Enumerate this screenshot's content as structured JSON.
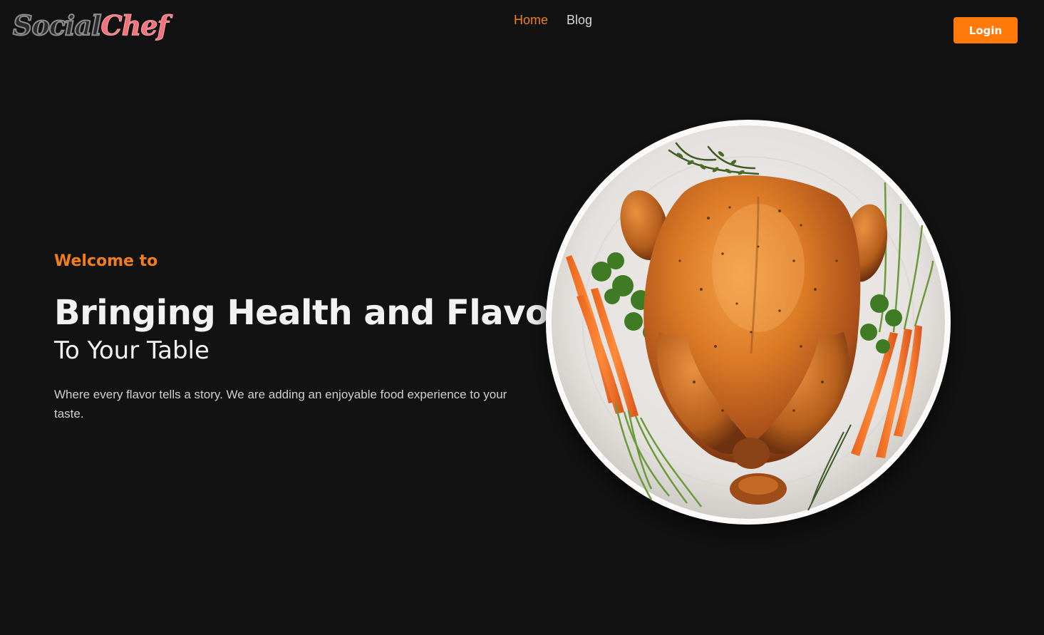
{
  "brand": {
    "logo_part1": "Social",
    "logo_part2": "Chef"
  },
  "nav": {
    "items": [
      {
        "label": "Home",
        "active": true
      },
      {
        "label": "Blog",
        "active": false
      }
    ]
  },
  "header": {
    "login_label": "Login"
  },
  "hero": {
    "welcome": "Welcome to",
    "headline": "Bringing Health and Flavor",
    "subheadline": "To Your Table",
    "description": "Where every flavor tells a story. We are adding an enjoyable food experience to your taste.",
    "image": "roast-chicken-plate"
  },
  "colors": {
    "background": "#121213",
    "accent": "#ff7a0a",
    "accent_text": "#f07e1e",
    "logo_pink": "#f0737b"
  }
}
